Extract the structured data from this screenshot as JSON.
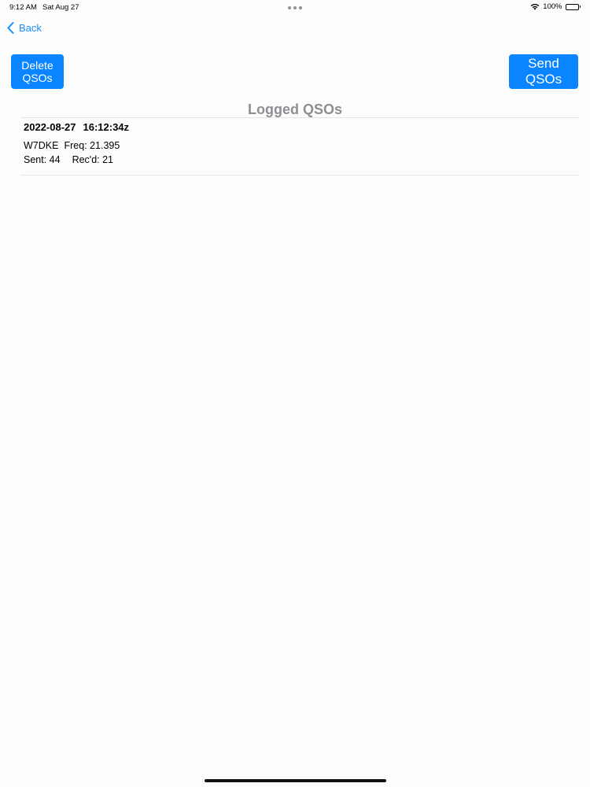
{
  "status_bar": {
    "time": "9:12 AM",
    "date": "Sat Aug 27",
    "battery": "100%"
  },
  "nav": {
    "back_label": "Back"
  },
  "buttons": {
    "delete_label": "Delete\nQSOs",
    "send_label": "Send\nQSOs"
  },
  "title": "Logged QSOs",
  "entries": [
    {
      "date": "2022-08-27",
      "time": "16:12:34z",
      "callsign": "W7DKE",
      "freq": "Freq: 21.395",
      "sent": "Sent: 44",
      "recd": "Rec'd: 21"
    }
  ],
  "colors": {
    "accent": "#0a84ff",
    "title_gray": "#8e8e93"
  }
}
